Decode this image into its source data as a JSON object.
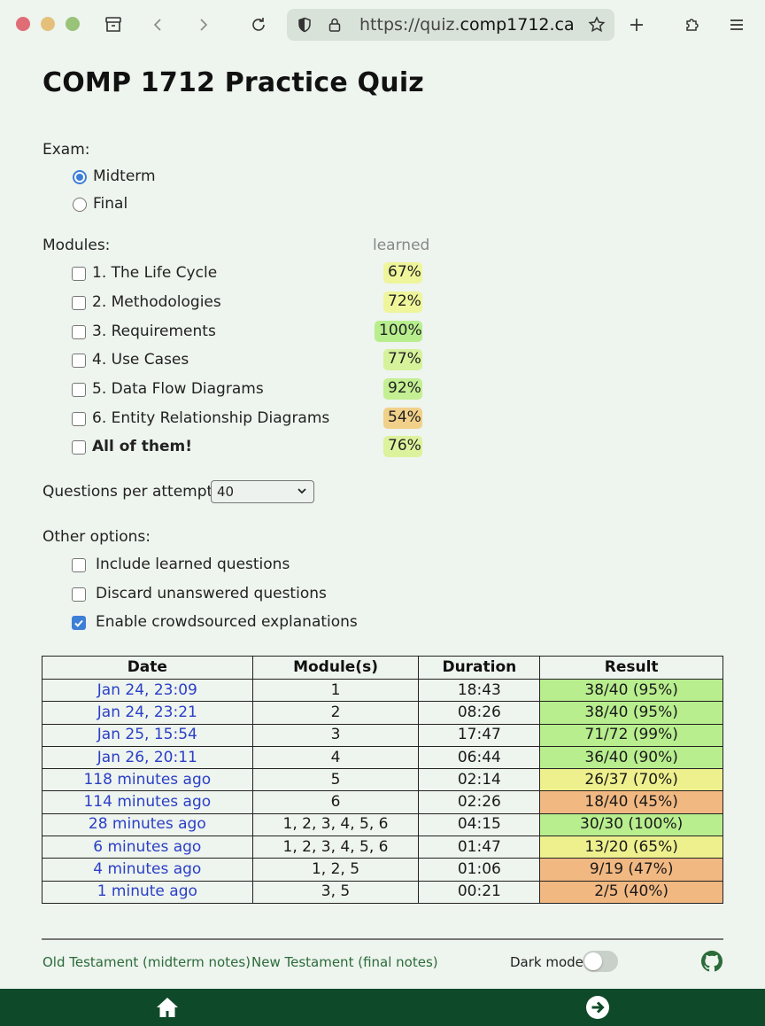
{
  "browser": {
    "url_prefix": "https://quiz.",
    "url_host": "comp1712.ca"
  },
  "page": {
    "title": "COMP 1712 Practice Quiz"
  },
  "exam": {
    "label": "Exam:",
    "options": [
      {
        "label": "Midterm",
        "selected": true
      },
      {
        "label": "Final",
        "selected": false
      }
    ]
  },
  "modules": {
    "label": "Modules:",
    "learned_header": "learned",
    "items": [
      {
        "label": "1. The Life Cycle",
        "learned": "67%",
        "color": "#eef59a"
      },
      {
        "label": "2. Methodologies",
        "learned": "72%",
        "color": "#eef59a"
      },
      {
        "label": "3. Requirements",
        "learned": "100%",
        "color": "#b8ee8e"
      },
      {
        "label": "4. Use Cases",
        "learned": "77%",
        "color": "#d6f29a"
      },
      {
        "label": "5. Data Flow Diagrams",
        "learned": "92%",
        "color": "#c4ef92"
      },
      {
        "label": "6. Entity Relationship Diagrams",
        "learned": "54%",
        "color": "#f1d089"
      },
      {
        "label": "All of them!",
        "learned": "76%",
        "color": "#dcf29c"
      }
    ]
  },
  "questions_per_attempt": {
    "label": "Questions per attempt:",
    "value": "40"
  },
  "other_options": {
    "label": "Other options:",
    "items": [
      {
        "label": "Include learned questions",
        "checked": false
      },
      {
        "label": "Discard unanswered questions",
        "checked": false
      },
      {
        "label": "Enable crowdsourced explanations",
        "checked": true
      }
    ]
  },
  "history": {
    "headers": [
      "Date",
      "Module(s)",
      "Duration",
      "Result"
    ],
    "rows": [
      {
        "date": "Jan 24, 23:09",
        "modules": "1",
        "duration": "18:43",
        "result": "38/40 (95%)",
        "color": "#b8ee8e"
      },
      {
        "date": "Jan 24, 23:21",
        "modules": "2",
        "duration": "08:26",
        "result": "38/40 (95%)",
        "color": "#b8ee8e"
      },
      {
        "date": "Jan 25, 15:54",
        "modules": "3",
        "duration": "17:47",
        "result": "71/72 (99%)",
        "color": "#b8ee8e"
      },
      {
        "date": "Jan 26, 20:11",
        "modules": "4",
        "duration": "06:44",
        "result": "36/40 (90%)",
        "color": "#b8ee8e"
      },
      {
        "date": "118 minutes ago",
        "modules": "5",
        "duration": "02:14",
        "result": "26/37 (70%)",
        "color": "#eef08e"
      },
      {
        "date": "114 minutes ago",
        "modules": "6",
        "duration": "02:26",
        "result": "18/40 (45%)",
        "color": "#f1b882"
      },
      {
        "date": "28 minutes ago",
        "modules": "1, 2, 3, 4, 5, 6",
        "duration": "04:15",
        "result": "30/30 (100%)",
        "color": "#b8ee8e"
      },
      {
        "date": "6 minutes ago",
        "modules": "1, 2, 3, 4, 5, 6",
        "duration": "01:47",
        "result": "13/20 (65%)",
        "color": "#eef08e"
      },
      {
        "date": "4 minutes ago",
        "modules": "1, 2, 5",
        "duration": "01:06",
        "result": "9/19 (47%)",
        "color": "#f1b882"
      },
      {
        "date": "1 minute ago",
        "modules": "3, 5",
        "duration": "00:21",
        "result": "2/5 (40%)",
        "color": "#f1b882"
      }
    ]
  },
  "footer": {
    "link_old": "Old Testament (midterm notes)",
    "link_new": "New Testament (final notes)",
    "dark_mode_label": "Dark mode",
    "dark_mode_on": false,
    "github_icon": "github-icon"
  },
  "bottom_bar": {
    "home_icon": "home-icon",
    "next_icon": "arrow-right-circle-icon"
  }
}
